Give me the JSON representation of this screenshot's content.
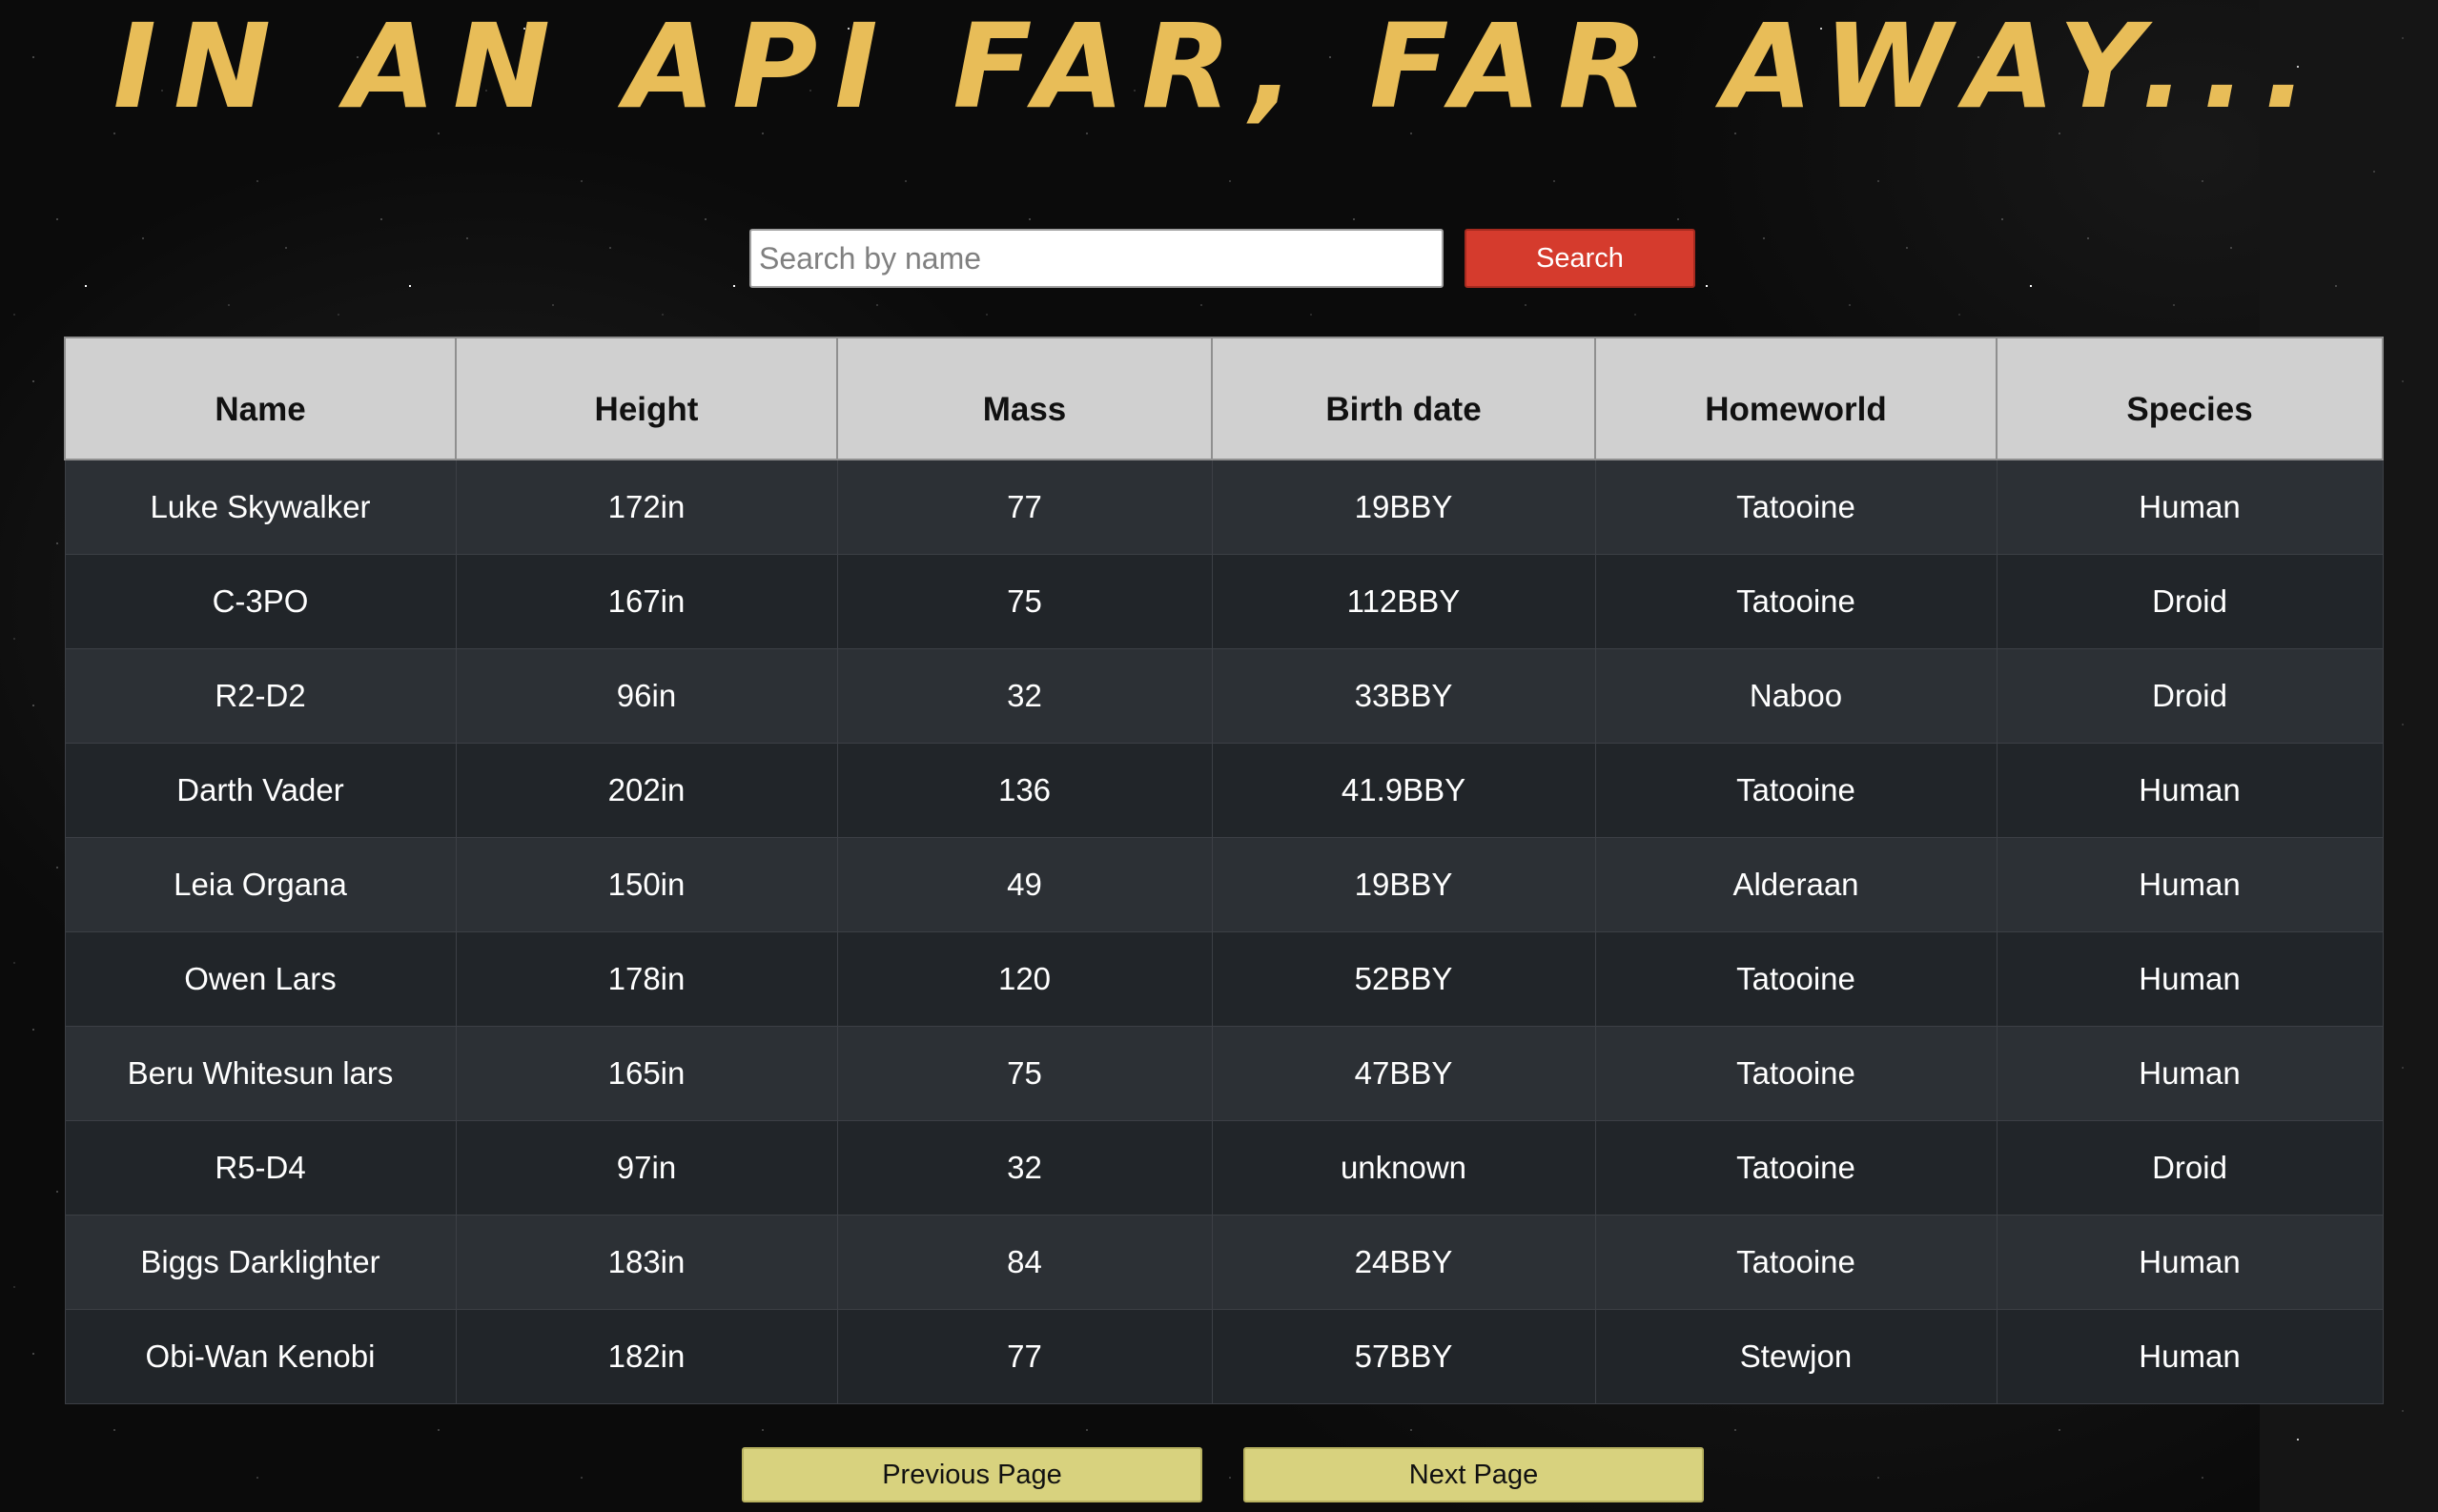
{
  "header": {
    "title": "IN AN API FAR, FAR AWAY..."
  },
  "search": {
    "placeholder": "Search by name",
    "value": "",
    "button_label": "Search"
  },
  "table": {
    "columns": [
      "Name",
      "Height",
      "Mass",
      "Birth date",
      "Homeworld",
      "Species"
    ],
    "rows": [
      [
        "Luke Skywalker",
        "172in",
        "77",
        "19BBY",
        "Tatooine",
        "Human"
      ],
      [
        "C-3PO",
        "167in",
        "75",
        "112BBY",
        "Tatooine",
        "Droid"
      ],
      [
        "R2-D2",
        "96in",
        "32",
        "33BBY",
        "Naboo",
        "Droid"
      ],
      [
        "Darth Vader",
        "202in",
        "136",
        "41.9BBY",
        "Tatooine",
        "Human"
      ],
      [
        "Leia Organa",
        "150in",
        "49",
        "19BBY",
        "Alderaan",
        "Human"
      ],
      [
        "Owen Lars",
        "178in",
        "120",
        "52BBY",
        "Tatooine",
        "Human"
      ],
      [
        "Beru Whitesun lars",
        "165in",
        "75",
        "47BBY",
        "Tatooine",
        "Human"
      ],
      [
        "R5-D4",
        "97in",
        "32",
        "unknown",
        "Tatooine",
        "Droid"
      ],
      [
        "Biggs Darklighter",
        "183in",
        "84",
        "24BBY",
        "Tatooine",
        "Human"
      ],
      [
        "Obi-Wan Kenobi",
        "182in",
        "77",
        "57BBY",
        "Stewjon",
        "Human"
      ]
    ]
  },
  "pagination": {
    "previous_label": "Previous Page",
    "next_label": "Next Page"
  },
  "colors": {
    "title": "#e8bd58",
    "search_button": "#d53b2d",
    "page_button": "#d8d27e",
    "header_row": "#d0d0d0",
    "row_odd": "#2c3035",
    "row_even": "#212529"
  }
}
